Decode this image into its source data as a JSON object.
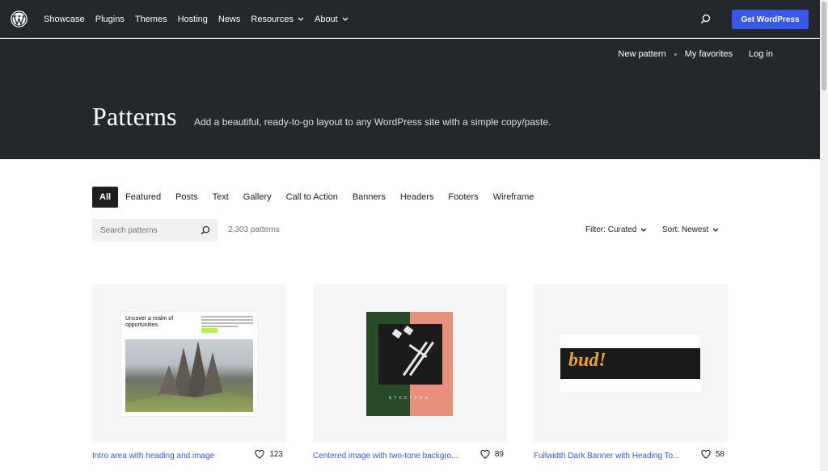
{
  "nav": {
    "links": [
      "Showcase",
      "Plugins",
      "Themes",
      "Hosting",
      "News",
      "Resources",
      "About"
    ],
    "cta_label": "Get WordPress"
  },
  "hero": {
    "sublinks": {
      "new_pattern": "New pattern",
      "my_favorites": "My favorites",
      "log_in": "Log in"
    },
    "title": "Patterns",
    "tagline": "Add a beautiful, ready-to-go layout to any WordPress site with a simple copy/paste."
  },
  "tabs": [
    "All",
    "Featured",
    "Posts",
    "Text",
    "Gallery",
    "Call to Action",
    "Banners",
    "Headers",
    "Footers",
    "Wireframe"
  ],
  "active_tab": "All",
  "search": {
    "placeholder": "Search patterns",
    "value": ""
  },
  "results_count": "2,303 patterns",
  "filter_label": "Filter: Curated",
  "sort_label": "Sort: Newest",
  "cards": [
    {
      "title": "Intro area with heading and image",
      "likes": "123",
      "preview": {
        "heading": "Uncover a realm of opportunities."
      }
    },
    {
      "title": "Centered image with two-tone backgro...",
      "likes": "89",
      "preview": {
        "label": "ETCETERA"
      }
    },
    {
      "title": "Fullwidth Dark Banner with Heading To...",
      "likes": "58",
      "preview": {
        "heading": "bud!"
      }
    }
  ],
  "colors": {
    "nav_bg": "#23282d",
    "accent": "#3858e9",
    "card_bg": "#f6f6f6",
    "active_tab_bg": "#1e1e1e"
  }
}
